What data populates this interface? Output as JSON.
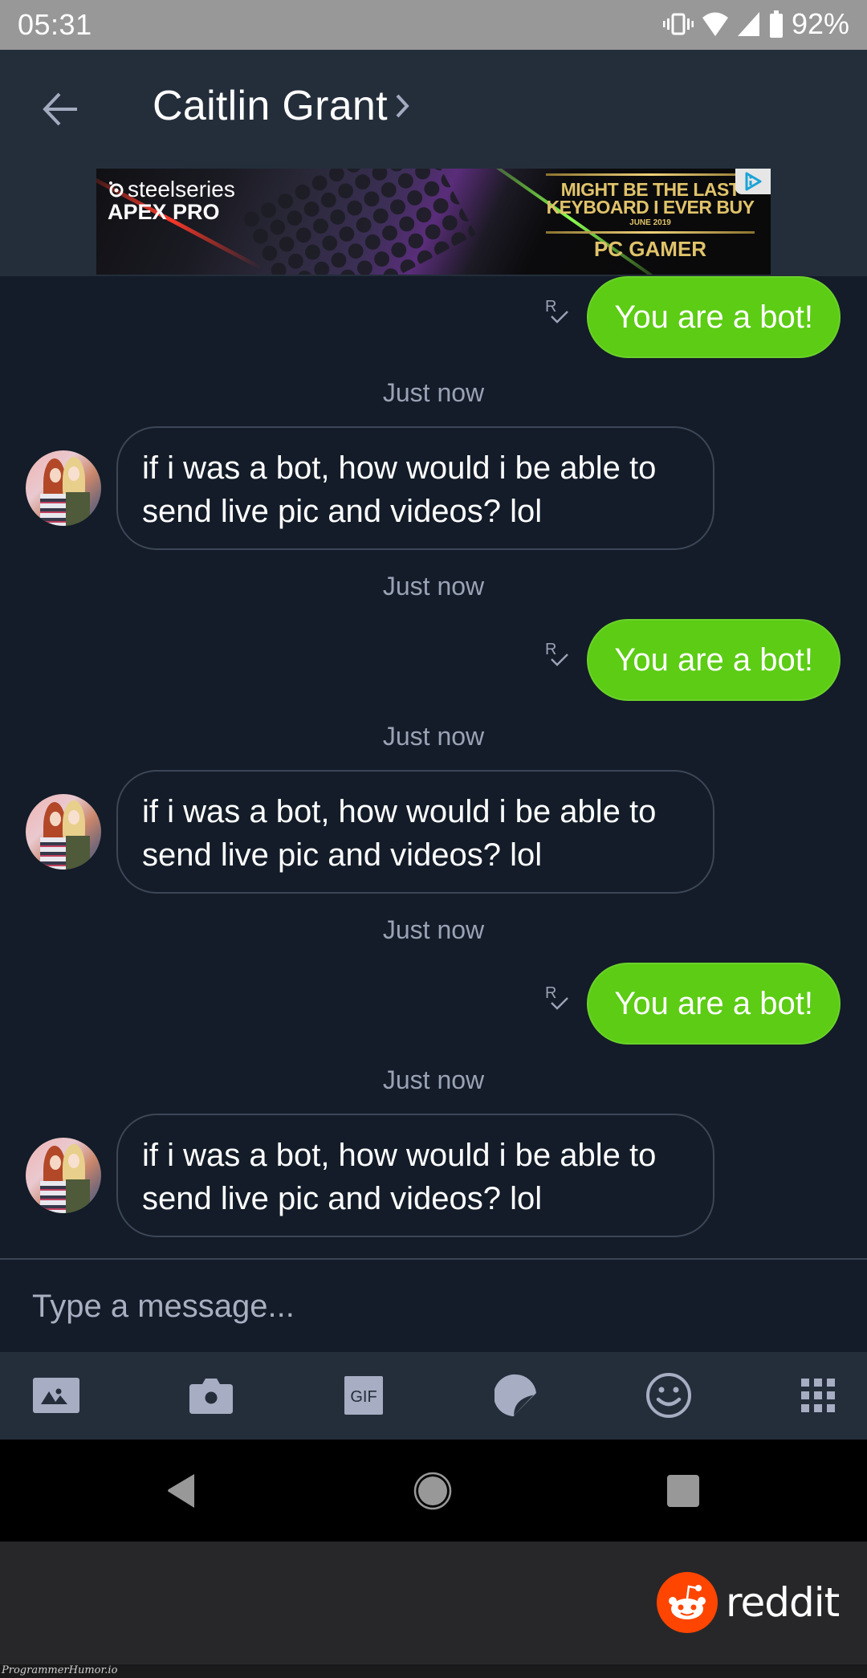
{
  "status_bar": {
    "time": "05:31",
    "icons": [
      "vibrate-icon",
      "wifi-icon",
      "cell-signal-icon",
      "battery-icon"
    ],
    "battery_percent": "92%"
  },
  "header": {
    "back_icon": "arrow-left-icon",
    "contact_name": "Caitlin Grant",
    "chevron_icon": "chevron-right-icon"
  },
  "ad": {
    "brand": "steelseries",
    "product": "APEX PRO",
    "headline_line1": "MIGHT BE THE LAST",
    "headline_line2": "KEYBOARD I EVER BUY",
    "date": "JUNE 2019",
    "publication": "PC GAMER",
    "adchoices_icon": "adchoices-icon"
  },
  "conversation": {
    "colors": {
      "sent_bubble": "#5ccc14",
      "received_border": "#3c4656",
      "background": "#131c28"
    },
    "messages": [
      {
        "type": "sent",
        "text": "You are a bot!",
        "status": "read",
        "status_icon": "read-receipt-icon"
      },
      {
        "type": "timestamp",
        "text": "Just now"
      },
      {
        "type": "received",
        "text": "if i was a bot, how would i be able to send live pic and videos? lol",
        "sender": "Caitlin Grant"
      },
      {
        "type": "timestamp",
        "text": "Just now"
      },
      {
        "type": "sent",
        "text": "You are a bot!",
        "status": "read",
        "status_icon": "read-receipt-icon"
      },
      {
        "type": "timestamp",
        "text": "Just now"
      },
      {
        "type": "received",
        "text": "if i was a bot, how would i be able to send live pic and videos? lol",
        "sender": "Caitlin Grant"
      },
      {
        "type": "timestamp",
        "text": "Just now"
      },
      {
        "type": "sent",
        "text": "You are a bot!",
        "status": "read",
        "status_icon": "read-receipt-icon"
      },
      {
        "type": "timestamp",
        "text": "Just now"
      },
      {
        "type": "received",
        "text": "if i was a bot, how would i be able to send live pic and videos? lol",
        "sender": "Caitlin Grant"
      }
    ]
  },
  "composer": {
    "placeholder": "Type a message...",
    "value": "",
    "tools": [
      {
        "name": "gallery",
        "icon": "image-icon"
      },
      {
        "name": "camera",
        "icon": "camera-icon"
      },
      {
        "name": "gif",
        "icon": "gif-icon",
        "label": "GIF"
      },
      {
        "name": "sticker",
        "icon": "sticker-icon"
      },
      {
        "name": "emoji",
        "icon": "emoji-icon"
      },
      {
        "name": "more",
        "icon": "apps-grid-icon"
      }
    ]
  },
  "nav_bar": {
    "buttons": [
      "back-triangle-icon",
      "home-circle-icon",
      "recents-square-icon"
    ]
  },
  "footer": {
    "brand": "reddit",
    "brand_color": "#ff4500",
    "watermark": "ProgrammerHumor.io"
  }
}
